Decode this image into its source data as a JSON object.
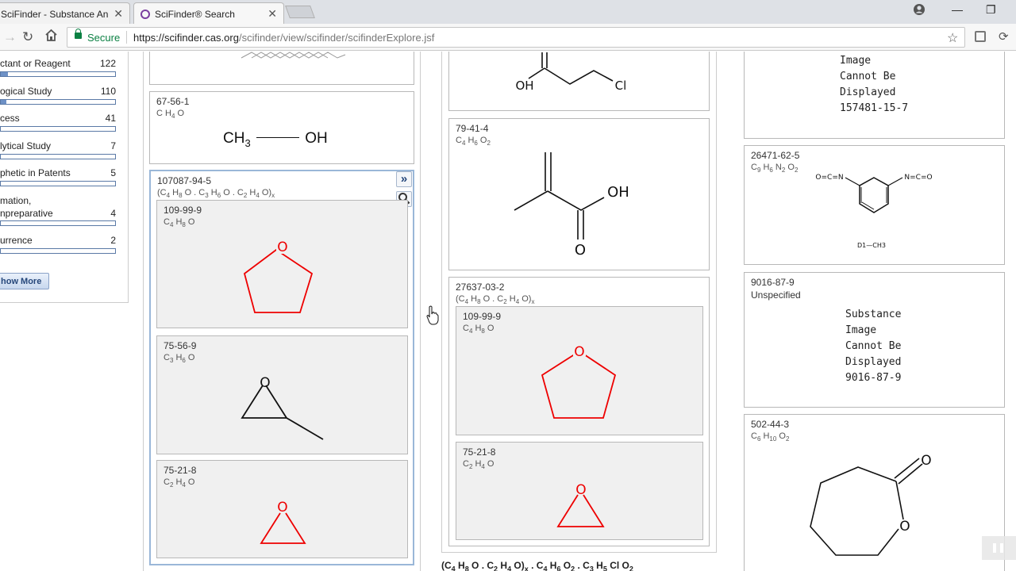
{
  "browser": {
    "tabs": [
      {
        "label": "SciFinder - Substance An"
      },
      {
        "label": "SciFinder® Search"
      }
    ],
    "secure_label": "Secure",
    "url_host": "https://scifinder.cas.org",
    "url_path": "/scifinder/view/scifinder/scifinderExplore.jsf"
  },
  "facets": {
    "items": [
      {
        "label": "ctant or Reagent",
        "count": "122",
        "fill": 0.06
      },
      {
        "label": "ogical Study",
        "count": "110",
        "fill": 0.05
      },
      {
        "label": "cess",
        "count": "41",
        "fill": 0.0
      },
      {
        "label": "lytical Study",
        "count": "7",
        "fill": 0.0
      },
      {
        "label": "phetic in Patents",
        "count": "5",
        "fill": 0.0
      },
      {
        "label": "mation,",
        "label2": "npreparative",
        "count": "4",
        "fill": 0.0
      },
      {
        "label": "urrence",
        "count": "2",
        "fill": 0.0
      }
    ],
    "show_more": "how More"
  },
  "col1": {
    "card_methanol": {
      "cas": "67-56-1",
      "formula_html": "C H<sub>4</sub> O",
      "struct_left": "CH",
      "struct_left_sub": "3",
      "struct_right": "OH"
    },
    "card_copolymer": {
      "cas": "107087-94-5",
      "formula_html": "(C<sub>4</sub> H<sub>8</sub> O . C<sub>3</sub> H<sub>6</sub> O . C<sub>2</sub> H<sub>4</sub> O)<sub>x</sub>",
      "expand_icon": "»",
      "sub": [
        {
          "cas": "109-99-9",
          "formula_html": "C<sub>4</sub> H<sub>8</sub> O"
        },
        {
          "cas": "75-56-9",
          "formula_html": "C<sub>3</sub> H<sub>6</sub> O"
        },
        {
          "cas": "75-21-8",
          "formula_html": "C<sub>2</sub> H<sub>4</sub> O"
        }
      ]
    }
  },
  "col2": {
    "card_chloroacid": {
      "atom_oh": "OH",
      "atom_cl": "Cl"
    },
    "card_methacrylic": {
      "cas": "79-41-4",
      "formula_html": "C<sub>4</sub> H<sub>6</sub> O<sub>2</sub>",
      "atom_oh": "OH",
      "atom_o": "O"
    },
    "card_copolymer2": {
      "cas": "27637-03-2",
      "formula_html": "(C<sub>4</sub> H<sub>8</sub> O . C<sub>2</sub> H<sub>4</sub> O)<sub>x</sub>",
      "sub": [
        {
          "cas": "109-99-9",
          "formula_html": "C<sub>4</sub> H<sub>8</sub> O"
        },
        {
          "cas": "75-21-8",
          "formula_html": "C<sub>2</sub> H<sub>4</sub> O"
        }
      ]
    },
    "bottom_formula_html": "(C<sub>4</sub> H<sub>8</sub> O . C<sub>2</sub> H<sub>4</sub> O)<sub>x</sub> . C<sub>4</sub> H<sub>6</sub> O<sub>2</sub> . C<sub>3</sub> H<sub>5</sub> Cl O<sub>2</sub>"
  },
  "col3": {
    "card_noimg1": {
      "text": "Image\nCannot Be\nDisplayed\n157481-15-7"
    },
    "card_diisocyanate": {
      "cas": "26471-62-5",
      "formula_html": "C<sub>9</sub> H<sub>6</sub> N<sub>2</sub> O<sub>2</sub>",
      "label_left": "O=C=N",
      "label_right": "N=C=O",
      "label_bottom": "D1—CH3"
    },
    "card_unspecified": {
      "cas": "9016-87-9",
      "formula": "Unspecified",
      "text": "Substance\nImage\nCannot Be\nDisplayed\n9016-87-9"
    },
    "card_caprolactone": {
      "cas": "502-44-3",
      "formula_html": "C<sub>6</sub> H<sub>10</sub> O<sub>2</sub>",
      "atom_o1": "O",
      "atom_o2": "O"
    }
  }
}
